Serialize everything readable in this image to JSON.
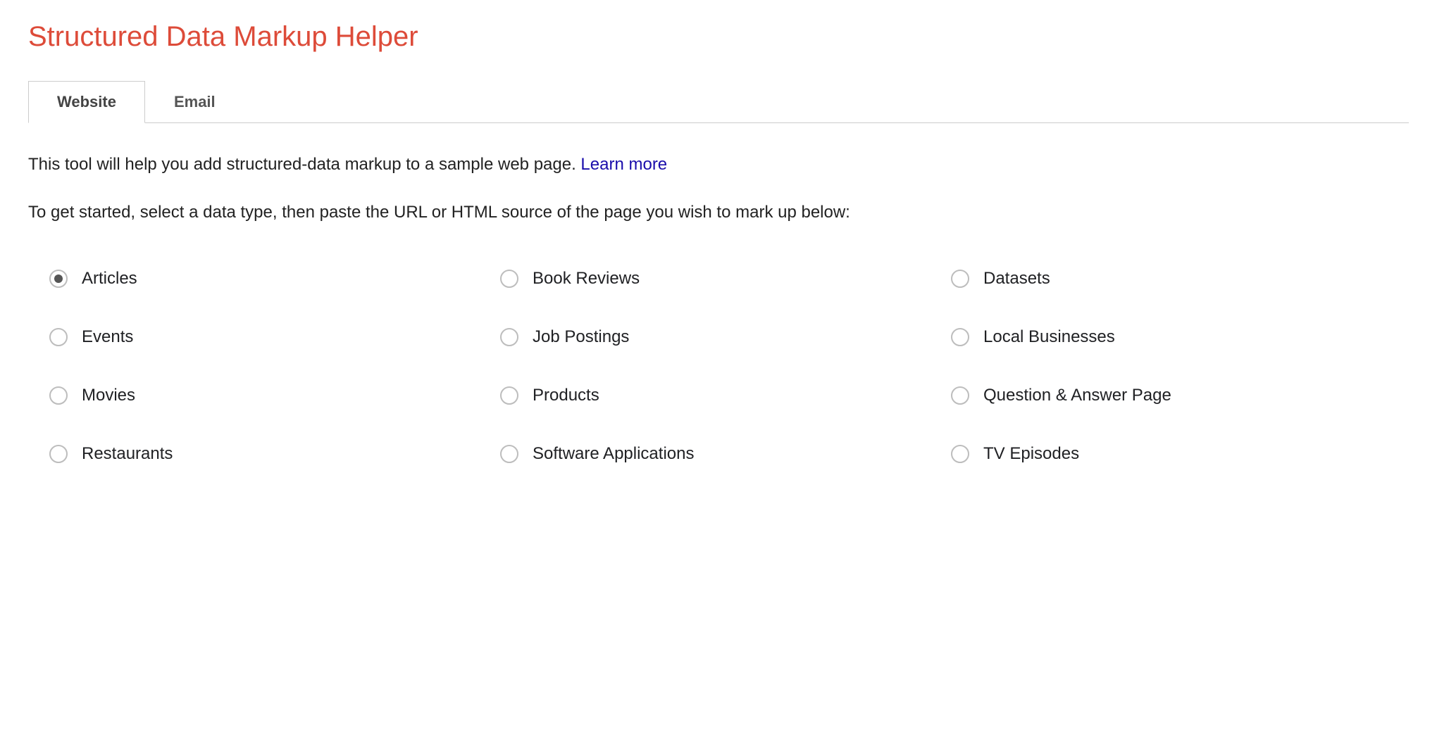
{
  "header": {
    "title": "Structured Data Markup Helper"
  },
  "tabs": [
    {
      "label": "Website",
      "active": true
    },
    {
      "label": "Email",
      "active": false
    }
  ],
  "intro": {
    "line1_prefix": "This tool will help you add structured-data markup to a sample web page. ",
    "learn_more": "Learn more",
    "line2": "To get started, select a data type, then paste the URL or HTML source of the page you wish to mark up below:"
  },
  "options": [
    {
      "label": "Articles",
      "selected": true
    },
    {
      "label": "Book Reviews",
      "selected": false
    },
    {
      "label": "Datasets",
      "selected": false
    },
    {
      "label": "Events",
      "selected": false
    },
    {
      "label": "Job Postings",
      "selected": false
    },
    {
      "label": "Local Businesses",
      "selected": false
    },
    {
      "label": "Movies",
      "selected": false
    },
    {
      "label": "Products",
      "selected": false
    },
    {
      "label": "Question & Answer Page",
      "selected": false
    },
    {
      "label": "Restaurants",
      "selected": false
    },
    {
      "label": "Software Applications",
      "selected": false
    },
    {
      "label": "TV Episodes",
      "selected": false
    }
  ]
}
